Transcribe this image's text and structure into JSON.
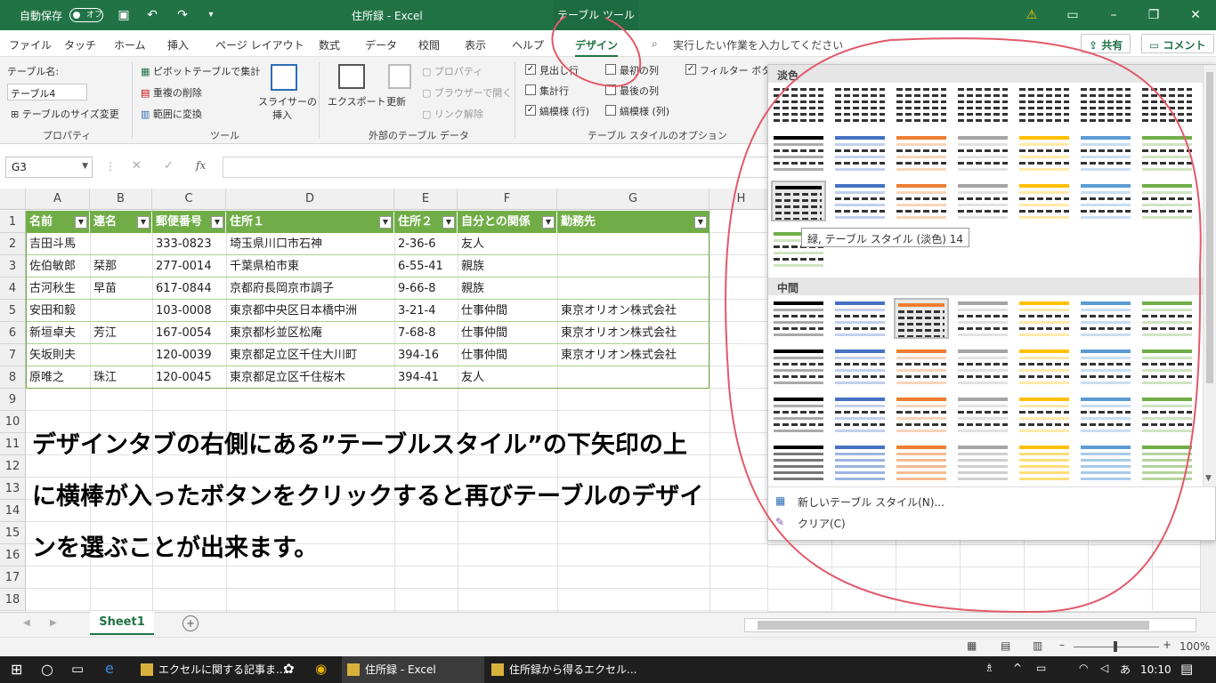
{
  "titlebar": {
    "autosave": "自動保存",
    "autosave_state": "オフ",
    "doc_title": "住所録 - Excel",
    "context_tab": "テーブル ツール"
  },
  "menu": {
    "tabs": [
      "ファイル",
      "タッチ",
      "ホーム",
      "挿入",
      "ページ レイアウト",
      "数式",
      "データ",
      "校閲",
      "表示",
      "ヘルプ",
      "デザイン"
    ],
    "search": "実行したい作業を入力してください",
    "share": "共有",
    "comment": "コメント"
  },
  "ribbon": {
    "table_name_label": "テーブル名:",
    "table_name": "テーブル4",
    "resize": "テーブルのサイズ変更",
    "group_props": "プロパティ",
    "pivot": "ピボットテーブルで集計",
    "dedupe": "重複の削除",
    "convert": "範囲に変換",
    "slicer": "スライサーの",
    "slicer2": "挿入",
    "group_tools": "ツール",
    "export": "エクスポート",
    "refresh": "更新",
    "properties": "プロパティ",
    "browser": "ブラウザーで開く",
    "unlink": "リンク解除",
    "group_external": "外部のテーブル データ",
    "opt_header": "見出し行",
    "opt_first": "最初の列",
    "opt_filter": "フィルター ボタン",
    "opt_total": "集計行",
    "opt_last": "最後の列",
    "opt_banded_rows": "縞模様 (行)",
    "opt_banded_cols": "縞模様 (列)",
    "group_options": "テーブル スタイルのオプション"
  },
  "formula": {
    "namebox": "G3",
    "fx": "fx"
  },
  "grid": {
    "columns": [
      "A",
      "B",
      "C",
      "D",
      "E",
      "F",
      "G",
      "H"
    ],
    "rows": [
      "1",
      "2",
      "3",
      "4",
      "5",
      "6",
      "7",
      "8",
      "9",
      "10",
      "11",
      "12",
      "13",
      "14",
      "15",
      "16",
      "17",
      "18"
    ],
    "headers": [
      "名前",
      "連名",
      "郵便番号",
      "住所１",
      "住所２",
      "自分との関係",
      "勤務先"
    ],
    "data": [
      [
        "吉田斗馬",
        "",
        "333-0823",
        "埼玉県川口市石神",
        "2-36-6",
        "友人",
        ""
      ],
      [
        "佐伯敏郎",
        "栞那",
        "277-0014",
        "千葉県柏市東",
        "6-55-41",
        "親族",
        ""
      ],
      [
        "古河秋生",
        "早苗",
        "617-0844",
        "京都府長岡京市調子",
        "9-66-8",
        "親族",
        ""
      ],
      [
        "安田和毅",
        "",
        "103-0008",
        "東京都中央区日本橋中洲",
        "3-21-4",
        "仕事仲間",
        "東京オリオン株式会社"
      ],
      [
        "新垣卓夫",
        "芳江",
        "167-0054",
        "東京都杉並区松庵",
        "7-68-8",
        "仕事仲間",
        "東京オリオン株式会社"
      ],
      [
        "矢坂則夫",
        "",
        "120-0039",
        "東京都足立区千住大川町",
        "394-16",
        "仕事仲間",
        "東京オリオン株式会社"
      ],
      [
        "原唯之",
        "珠江",
        "120-0045",
        "東京都足立区千住桜木",
        "394-41",
        "友人",
        ""
      ]
    ]
  },
  "annotation": {
    "line1": "デザインタブの右側にある”テーブルスタイル”の下矢印の上",
    "line2": "に横棒が入ったボタンをクリックすると再びテーブルのデザイ",
    "line3": "ンを選ぶことが出来ます。"
  },
  "gallery": {
    "light": "淡色",
    "medium": "中間",
    "tooltip": "緑, テーブル スタイル (淡色) 14",
    "new_style": "新しいテーブル スタイル(N)...",
    "clear": "クリア(C)",
    "colors": [
      "#000000",
      "#4472c4",
      "#ed7d31",
      "#a5a5a5",
      "#ffc000",
      "#5b9bd5",
      "#70ad47"
    ]
  },
  "sheets": {
    "active": "Sheet1"
  },
  "status": {
    "zoom": "100%"
  },
  "taskbar": {
    "items": [
      "エクセルに関する記事ま...",
      "住所録 - Excel",
      "住所録から得るエクセル..."
    ],
    "time": "10:10"
  }
}
